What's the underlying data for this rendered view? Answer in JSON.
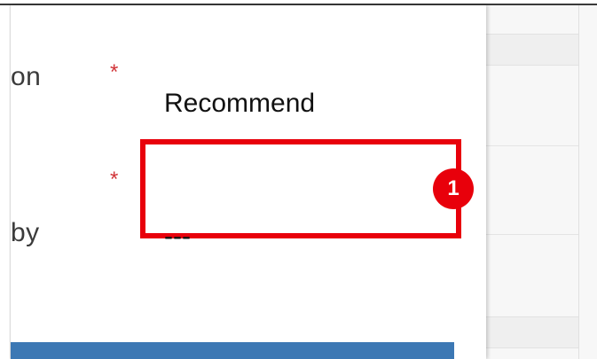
{
  "form": {
    "field1_label_fragment": "on",
    "field1_required_marker": "*",
    "field1_value": "Recommend",
    "field2_required_marker": "*",
    "field2_value": "",
    "field3_label_fragment": "by",
    "field3_value": "---"
  },
  "annotation": {
    "step_number": "1",
    "highlight_color": "#e8000b"
  },
  "colors": {
    "required_star": "#d13438",
    "primary_bar": "#3c78b4"
  }
}
